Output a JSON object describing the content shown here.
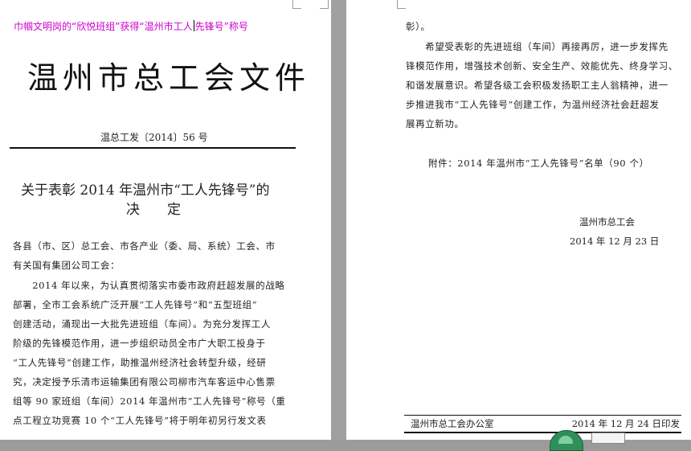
{
  "left_page": {
    "banner_before": "巾帼文明岗的“欣悦班组”获得“温州市工人",
    "banner_after": "先锋号”称号",
    "doc_title": "温州市总工会文件",
    "doc_number": "温总工发〔2014〕56 号",
    "heading_line1": "关于表彰 2014 年温州市“工人先锋号”的",
    "heading_line2": "决　　定",
    "body_lines": [
      "各县（市、区）总工会、市各产业（委、局、系统）工会、市",
      "有关国有集团公司工会：",
      "　　2014 年以来，为认真贯彻落实市委市政府赶超发展的战略",
      "部署，全市工会系统广泛开展“工人先锋号”和“五型班组”",
      "创建活动，涌现出一大批先进班组（车间）。为充分发挥工人",
      "阶级的先锋模范作用，进一步组织动员全市广大职工投身于",
      "“工人先锋号”创建工作，助推温州经济社会转型升级，经研",
      "究，决定授予乐清市运输集团有限公司柳市汽车客运中心售票",
      "组等 90 家班组（车间）2014 年温州市“工人先锋号”称号（重",
      "点工程立功竞赛 10 个“工人先锋号”将于明年初另行发文表"
    ]
  },
  "right_page": {
    "body_lines": [
      "彰）。",
      "　　希望受表彰的先进班组（车间）再接再厉，进一步发挥先",
      "锋模范作用，增强技术创新、安全生产、效能优先、终身学习、",
      "和谐发展意识。希望各级工会积极发扬职工主人翁精神，进一",
      "步推进我市“工人先锋号”创建工作，为温州经济社会赶超发",
      "展再立新功。"
    ],
    "attachment": "附件：2014 年温州市“工人先锋号”名单（90 个）",
    "sign_org": "温州市总工会",
    "sign_date": "2014 年 12 月 23 日",
    "footer_org": "温州市总工会办公室",
    "footer_date": "2014 年 12 月 24 日印发"
  }
}
